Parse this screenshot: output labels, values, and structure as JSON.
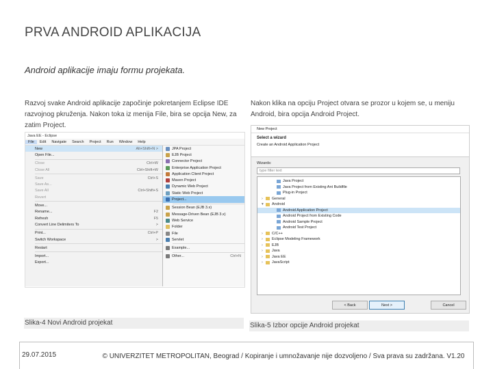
{
  "slide": {
    "title": "PRVA ANDROID APLIKACIJA",
    "subtitle": "Android aplikacije imaju formu projekata.",
    "left_paragraph": "Razvoj svake Android aplikacije započinje pokretanjem Eclipse IDE razvojnog pkruženja. Nakon toka iz menija File, bira se opcija New, za zatim Project.",
    "right_paragraph": "Nakon klika na opciju Project otvara se prozor u kojem se, u meniju Android, bira opcija Android Project.",
    "caption_left": "Slika-4 Novi Android projekat",
    "caption_right": "Slika-5 Izbor opcije Android projekat",
    "footer_date": "29.07.2015",
    "footer_copyright": "© UNIVERZITET METROPOLITAN, Beograd / Kopiranje i umnožavanje nije dozvoljeno / Sva prava su zadržana. V1.20"
  },
  "eclipse": {
    "window_title": "Java EE - Eclipse",
    "menubar": [
      "File",
      "Edit",
      "Navigate",
      "Search",
      "Project",
      "Run",
      "Window",
      "Help"
    ],
    "file_menu": [
      {
        "label": "New",
        "shortcut": "Alt+Shift+N >"
      },
      {
        "label": "Open File...",
        "shortcut": ""
      },
      {
        "label": "Close",
        "shortcut": "Ctrl+W"
      },
      {
        "label": "Close All",
        "shortcut": "Ctrl+Shift+W"
      },
      {
        "label": "Save",
        "shortcut": "Ctrl+S"
      },
      {
        "label": "Save As...",
        "shortcut": ""
      },
      {
        "label": "Save All",
        "shortcut": "Ctrl+Shift+S"
      },
      {
        "label": "Revert",
        "shortcut": ""
      },
      {
        "label": "Move...",
        "shortcut": ""
      },
      {
        "label": "Rename...",
        "shortcut": "F2"
      },
      {
        "label": "Refresh",
        "shortcut": "F5"
      },
      {
        "label": "Convert Line Delimiters To",
        "shortcut": ">"
      },
      {
        "label": "Print...",
        "shortcut": "Ctrl+P"
      },
      {
        "label": "Switch Workspace",
        "shortcut": ">"
      },
      {
        "label": "Restart",
        "shortcut": ""
      },
      {
        "label": "Import...",
        "shortcut": ""
      },
      {
        "label": "Export...",
        "shortcut": ""
      }
    ],
    "new_submenu": [
      "JPA Project",
      "EJB Project",
      "Connector Project",
      "Enterprise Application Project",
      "Application Client Project",
      "Maven Project",
      "Dynamic Web Project",
      "Static Web Project",
      "Project...",
      "Session Bean (EJB 3.x)",
      "Message-Driven Bean (EJB 3.x)",
      "Web Service",
      "Folder",
      "File",
      "Servlet",
      "Example...",
      "Other..."
    ],
    "other_shortcut": "Ctrl+N"
  },
  "wizard": {
    "window_title": "New Project",
    "heading": "Select a wizard",
    "description": "Create an Android Application Project",
    "wizards_label": "Wizards:",
    "filter_placeholder": "type filter text",
    "tree": [
      "Java Project",
      "Java Project from Existing Ant Buildfile",
      "Plug-in Project",
      "General",
      "Android",
      "Android Application Project",
      "Android Project from Existing Code",
      "Android Sample Project",
      "Android Test Project",
      "C/C++",
      "Eclipse Modeling Framework",
      "EJB",
      "Java",
      "Java EE",
      "JavaScript"
    ],
    "buttons": {
      "back": "< Back",
      "next": "Next >",
      "cancel": "Cancel"
    }
  },
  "colors": {
    "highlight": "#cce4f7",
    "accent": "#3c7fb1",
    "caption_bg": "#eeeeee"
  }
}
